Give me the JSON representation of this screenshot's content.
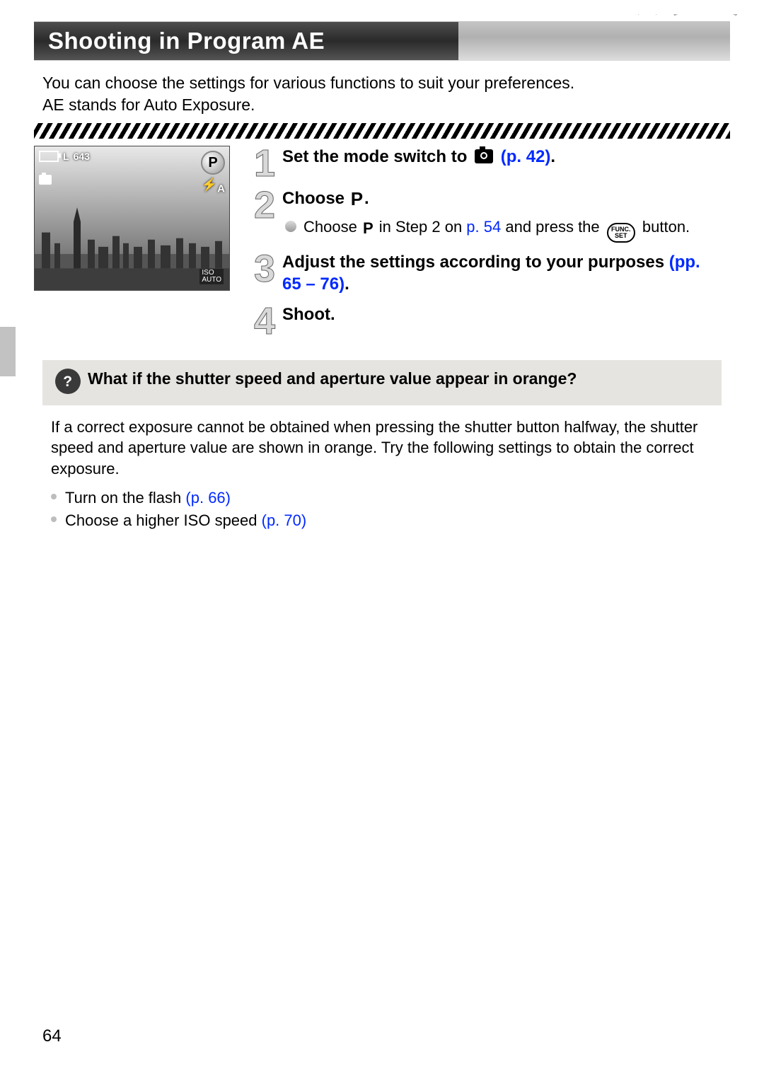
{
  "title": "Shooting in Program AE",
  "intro_line1": "You can choose the settings for various functions to suit your preferences.",
  "intro_line2": "AE stands for Auto Exposure.",
  "lcd": {
    "shots_remaining": "643",
    "quality": "L",
    "mode_badge": "P",
    "flash_mode": "A",
    "iso_label_top": "ISO",
    "iso_label_bottom": "AUTO"
  },
  "steps": [
    {
      "num": "1",
      "head_prefix": "Set the mode switch to ",
      "head_link": "(p. 42)",
      "head_suffix": "."
    },
    {
      "num": "2",
      "head_prefix": "Choose ",
      "head_suffix": ".",
      "sub_prefix": "Choose ",
      "sub_mid": " in Step 2 on ",
      "sub_link": "p. 54",
      "sub_after_link": " and press the ",
      "sub_end": " button.",
      "func_top": "FUNC.",
      "func_bottom": "SET"
    },
    {
      "num": "3",
      "head_prefix": "Adjust the settings according to your purposes ",
      "head_link": "(pp. 65 – 76)",
      "head_suffix": "."
    },
    {
      "num": "4",
      "head_prefix": "Shoot."
    }
  ],
  "tip": {
    "heading": "What if the shutter speed and aperture value appear in orange?",
    "para": "If a correct exposure cannot be obtained when pressing the shutter button halfway, the shutter speed and aperture value are shown in orange. Try the following settings to obtain the correct exposure.",
    "items": [
      {
        "text": "Turn on the flash ",
        "link": "(p. 66)"
      },
      {
        "text": "Choose a higher ISO speed ",
        "link": "(p. 70)"
      }
    ]
  },
  "page_number": "64"
}
